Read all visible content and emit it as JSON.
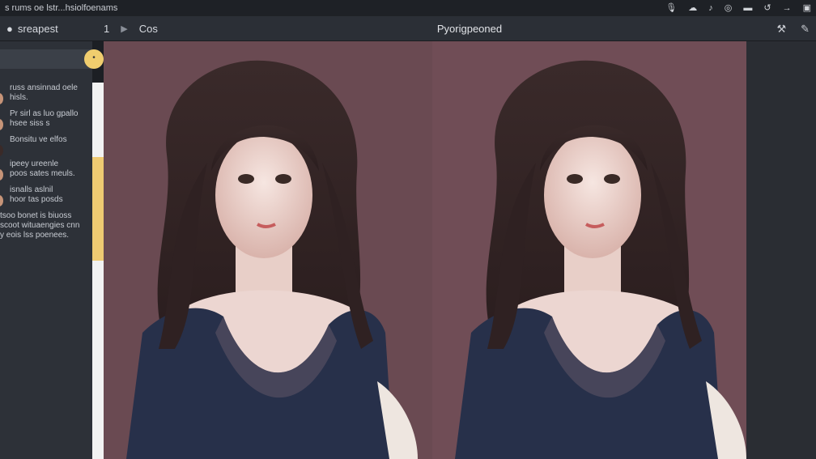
{
  "system_bar": {
    "title": "s  rums oe lstr...hsiolfoenams",
    "icons": [
      "mic-icon",
      "cloud-icon",
      "note-icon",
      "record-icon",
      "battery-icon",
      "undo-icon",
      "redo-icon",
      "ai-icon"
    ]
  },
  "toolbar": {
    "app_label": "sreapest",
    "tab_number": "1",
    "tab_label": "Cos",
    "title": "Pyorigpeoned",
    "right_icons": [
      "wrench-icon",
      "pen-icon"
    ]
  },
  "sidebar": {
    "search_placeholder": "",
    "chats": [
      {
        "line1": "russ ansinnad oele",
        "line2": "hisls."
      },
      {
        "line1": "Pr sirl as luo gpallo",
        "line2": "hsee siss s"
      },
      {
        "line1": "Bonsitu ve elfos",
        "line2": ""
      },
      {
        "line1": "ipeey ureenle",
        "line2": "poos sates meuls."
      },
      {
        "line1": "isnalls aslnil",
        "line2": "hoor tas posds"
      }
    ],
    "note": [
      "tsoo bonet is biuoss",
      "scoot wituaengies cnn",
      "y eois lss poenees."
    ]
  },
  "colors": {
    "accent": "#efca72",
    "canvas": "#6a4a52",
    "sidebar": "#2d3138"
  }
}
